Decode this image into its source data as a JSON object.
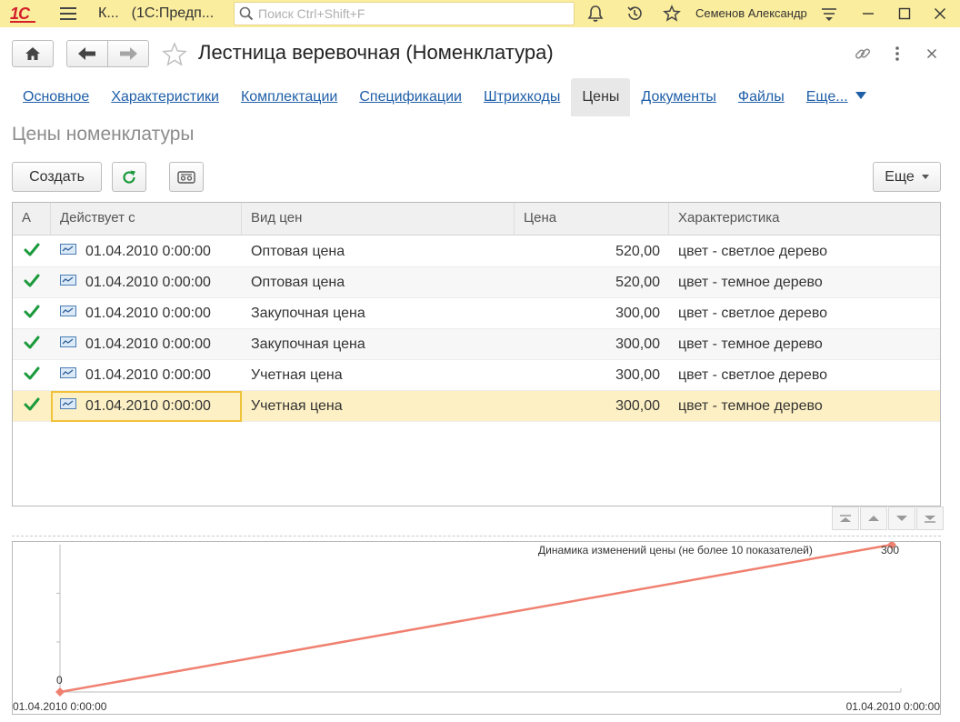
{
  "topbar": {
    "logo": "1С",
    "app_title_part1": "К...",
    "app_title_part2": "(1С:Предп...",
    "search_placeholder": "Поиск Ctrl+Shift+F",
    "username": "Семенов Александр",
    "icons": [
      "menu-icon",
      "bell-icon",
      "history-icon",
      "star-icon",
      "settings-icon",
      "minimize-icon",
      "maximize-icon",
      "close-icon"
    ]
  },
  "form": {
    "title": "Лестница веревочная (Номенклатура)"
  },
  "tabs": [
    {
      "label": "Основное",
      "active": false
    },
    {
      "label": "Характеристики",
      "active": false
    },
    {
      "label": "Комплектации",
      "active": false
    },
    {
      "label": "Спецификации",
      "active": false
    },
    {
      "label": "Штрихкоды",
      "active": false
    },
    {
      "label": "Цены",
      "active": true
    },
    {
      "label": "Документы",
      "active": false
    },
    {
      "label": "Файлы",
      "active": false
    },
    {
      "label": "Еще...",
      "active": false
    }
  ],
  "section_title": "Цены номенклатуры",
  "toolbar": {
    "create_label": "Создать",
    "more_label": "Еще"
  },
  "table": {
    "columns": [
      "А",
      "Действует с",
      "Вид цен",
      "Цена",
      "Характеристика"
    ],
    "rows": [
      {
        "active": true,
        "date": "01.04.2010 0:00:00",
        "price_type": "Оптовая цена",
        "price": "520,00",
        "characteristic": "цвет - светлое дерево"
      },
      {
        "active": true,
        "date": "01.04.2010 0:00:00",
        "price_type": "Оптовая цена",
        "price": "520,00",
        "characteristic": "цвет - темное дерево"
      },
      {
        "active": true,
        "date": "01.04.2010 0:00:00",
        "price_type": "Закупочная цена",
        "price": "300,00",
        "characteristic": "цвет - светлое дерево"
      },
      {
        "active": true,
        "date": "01.04.2010 0:00:00",
        "price_type": "Закупочная цена",
        "price": "300,00",
        "characteristic": "цвет - темное дерево"
      },
      {
        "active": true,
        "date": "01.04.2010 0:00:00",
        "price_type": "Учетная цена",
        "price": "300,00",
        "characteristic": "цвет - светлое дерево"
      },
      {
        "active": true,
        "date": "01.04.2010 0:00:00",
        "price_type": "Учетная цена",
        "price": "300,00",
        "characteristic": "цвет - темное дерево"
      }
    ],
    "selected_row": 5
  },
  "chart_data": {
    "type": "line",
    "title": "Динамика изменений цены (не более 10 показателей)",
    "x": [
      "01.04.2010 0:00:00",
      "01.04.2010 0:00:00"
    ],
    "series": [
      {
        "values": [
          0,
          300
        ],
        "color": "#f08070"
      }
    ],
    "y_tick_labels": [
      "0",
      "300"
    ],
    "ylim": [
      0,
      300
    ],
    "grid": false
  },
  "colors": {
    "topbar_bg": "#fbed9e",
    "link": "#1f5fa8",
    "check": "#1a9a3c",
    "selected_row": "#fdf0c4",
    "chart_line": "#f08070"
  }
}
